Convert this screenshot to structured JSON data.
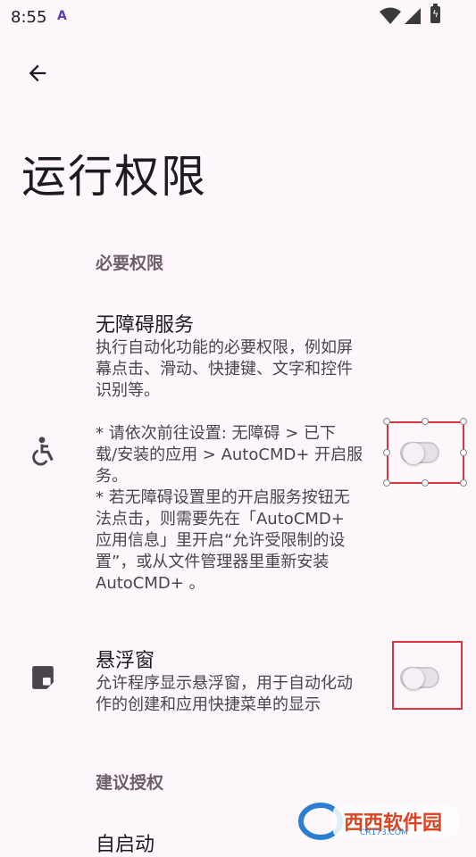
{
  "status_bar": {
    "time": "8:55",
    "app_icon": "A",
    "battery_icon": "battery-charging"
  },
  "header": {
    "back_icon": "arrow-back",
    "title": "运行权限"
  },
  "sections": {
    "required": {
      "label": "必要权限"
    },
    "suggested": {
      "label": "建议授权"
    }
  },
  "items": {
    "accessibility": {
      "icon": "accessibility-icon",
      "title": "无障碍服务",
      "desc": "执行自动化功能的必要权限，例如屏\n幕点击、滑动、快捷键、文字和控件\n识别等。\n\n* 请依次前往设置: 无障碍 > 已下\n载/安装的应用 > AutoCMD+ 开启服\n务。\n* 若无障碍设置里的开启服务按钮无\n法点击，则需要先在「AutoCMD+\n应用信息」里开启“允许受限制的设\n置”，或从文件管理器里重新安装\nAutoCMD+ 。",
      "enabled": false
    },
    "overlay": {
      "icon": "picture-in-picture-icon",
      "title": "悬浮窗",
      "desc": "允许程序显示悬浮窗，用于自动化动\n作的创建和应用快捷菜单的显示",
      "enabled": false
    },
    "autostart": {
      "title": "自启动"
    }
  },
  "watermark": {
    "text": "西西软件园",
    "sub": "CR173.COM"
  },
  "colors": {
    "background": "#fdf7fc",
    "selection": "#d9363e",
    "accent": "#5b3fb0"
  }
}
